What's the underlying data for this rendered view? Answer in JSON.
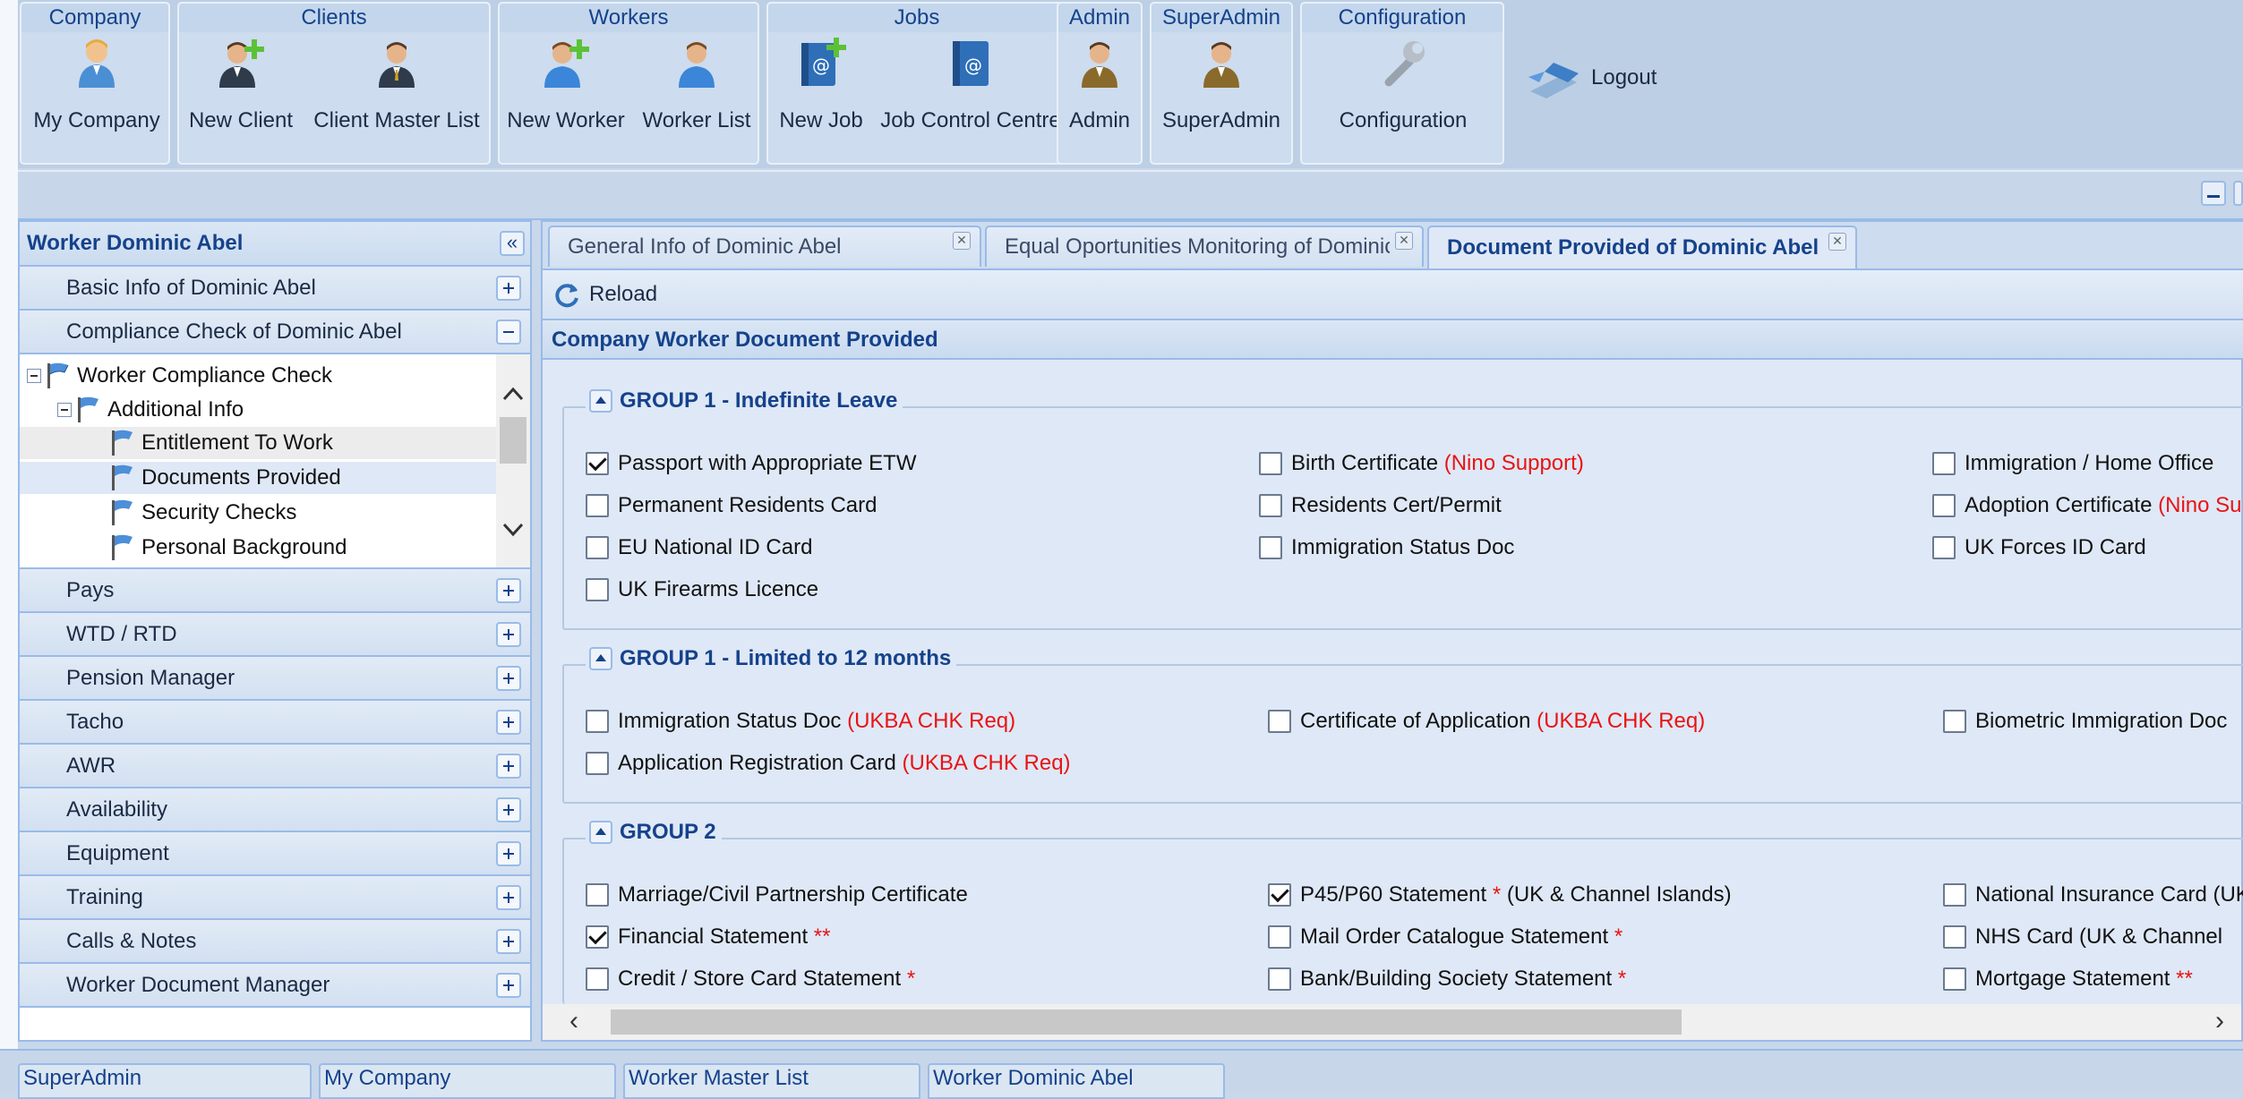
{
  "ribbon": {
    "groups": [
      {
        "title": "Company",
        "buttons": [
          {
            "label": "My Company",
            "icon": "person-icon"
          }
        ]
      },
      {
        "title": "Clients",
        "buttons": [
          {
            "label": "New Client",
            "icon": "add-user-icon"
          },
          {
            "label": "Client Master List",
            "icon": "business-person-icon"
          }
        ]
      },
      {
        "title": "Workers",
        "buttons": [
          {
            "label": "New Worker",
            "icon": "add-user-icon"
          },
          {
            "label": "Worker List",
            "icon": "person-icon"
          }
        ]
      },
      {
        "title": "Jobs",
        "buttons": [
          {
            "label": "New Job",
            "icon": "add-book-icon"
          },
          {
            "label": "Job Control Centre",
            "icon": "address-book-icon"
          }
        ]
      },
      {
        "title": "Admin",
        "buttons": [
          {
            "label": "Admin",
            "icon": "admin-person-icon"
          }
        ]
      },
      {
        "title": "SuperAdmin",
        "buttons": [
          {
            "label": "SuperAdmin",
            "icon": "admin-person-icon"
          }
        ]
      },
      {
        "title": "Configuration",
        "buttons": [
          {
            "label": "Configuration",
            "icon": "wrench-icon"
          }
        ]
      }
    ],
    "logout_label": "Logout"
  },
  "left_panel": {
    "title": "Worker Dominic Abel",
    "items_top": [
      {
        "label": "Basic Info of Dominic Abel",
        "expanded": false
      },
      {
        "label": "Compliance Check of Dominic Abel",
        "expanded": true
      }
    ],
    "tree": [
      {
        "label": "Worker Compliance Check",
        "level": 0,
        "toggle": true
      },
      {
        "label": "Additional Info",
        "level": 1,
        "toggle": true
      },
      {
        "label": "Entitlement To Work",
        "level": 2,
        "state": "alt"
      },
      {
        "label": "Documents Provided",
        "level": 2,
        "state": "selected"
      },
      {
        "label": "Security Checks",
        "level": 2
      },
      {
        "label": "Personal Background",
        "level": 2
      }
    ],
    "items_bottom": [
      {
        "label": "Pays"
      },
      {
        "label": "WTD / RTD"
      },
      {
        "label": "Pension Manager"
      },
      {
        "label": "Tacho"
      },
      {
        "label": "AWR"
      },
      {
        "label": "Availability"
      },
      {
        "label": "Equipment"
      },
      {
        "label": "Training"
      },
      {
        "label": "Calls & Notes"
      },
      {
        "label": "Worker Document Manager"
      }
    ]
  },
  "tabs": [
    {
      "label": "General Info of Dominic Abel",
      "active": false
    },
    {
      "label": "Equal Oportunities Monitoring of Dominic Abel",
      "active": false
    },
    {
      "label": "Document Provided of Dominic Abel",
      "active": true
    }
  ],
  "toolbar": {
    "reload_label": "Reload"
  },
  "form": {
    "title": "Company Worker Document Provided",
    "groups": [
      {
        "title": "GROUP 1 - Indefinite Leave",
        "items": [
          {
            "label": "Passport with Appropriate ETW",
            "note": "",
            "checked": true
          },
          {
            "label": "Birth Certificate",
            "note": "(Nino Support)",
            "checked": false
          },
          {
            "label": "Immigration / Home Office",
            "note": "",
            "checked": false
          },
          {
            "label": "Permanent Residents Card",
            "note": "",
            "checked": false
          },
          {
            "label": "Residents Cert/Permit",
            "note": "",
            "checked": false
          },
          {
            "label": "Adoption Certificate",
            "note": "(Nino Support)",
            "checked": false
          },
          {
            "label": "EU National ID Card",
            "note": "",
            "checked": false
          },
          {
            "label": "Immigration Status Doc",
            "note": "",
            "checked": false
          },
          {
            "label": "UK Forces ID Card",
            "note": "",
            "checked": false
          },
          {
            "label": "UK Firearms Licence",
            "note": "",
            "checked": false
          }
        ]
      },
      {
        "title": "GROUP 1 - Limited to 12 months",
        "items": [
          {
            "label": "Immigration Status Doc",
            "note": "(UKBA CHK Req)",
            "checked": false
          },
          {
            "label": "Certificate of Application",
            "note": "(UKBA CHK Req)",
            "checked": false
          },
          {
            "label": "Biometric Immigration Doc",
            "note": "",
            "checked": false
          },
          {
            "label": "Application Registration Card",
            "note": "(UKBA CHK Req)",
            "checked": false
          }
        ]
      },
      {
        "title": "GROUP 2",
        "items": [
          {
            "label": "Marriage/Civil Partnership Certificate",
            "note": "",
            "suffix": "",
            "checked": false
          },
          {
            "label": "P45/P60 Statement",
            "note": "*",
            "suffix": "(UK & Channel Islands)",
            "checked": true
          },
          {
            "label": "National Insurance Card (UK",
            "note": "",
            "suffix": "",
            "checked": false
          },
          {
            "label": "Financial Statement",
            "note": "**",
            "suffix": "",
            "checked": true
          },
          {
            "label": "Mail Order Catalogue Statement",
            "note": "*",
            "suffix": "",
            "checked": false
          },
          {
            "label": "NHS Card (UK & Channel",
            "note": "",
            "suffix": "",
            "checked": false
          },
          {
            "label": "Credit / Store Card Statement",
            "note": "*",
            "suffix": "",
            "checked": false
          },
          {
            "label": "Bank/Building Society Statement",
            "note": "*",
            "suffix": "",
            "checked": false
          },
          {
            "label": "Mortgage Statement",
            "note": "**",
            "suffix": "",
            "checked": false
          }
        ]
      }
    ]
  },
  "taskbar": [
    {
      "label": "SuperAdmin"
    },
    {
      "label": "My Company"
    },
    {
      "label": "Worker Master List"
    },
    {
      "label": "Worker Dominic Abel"
    }
  ]
}
